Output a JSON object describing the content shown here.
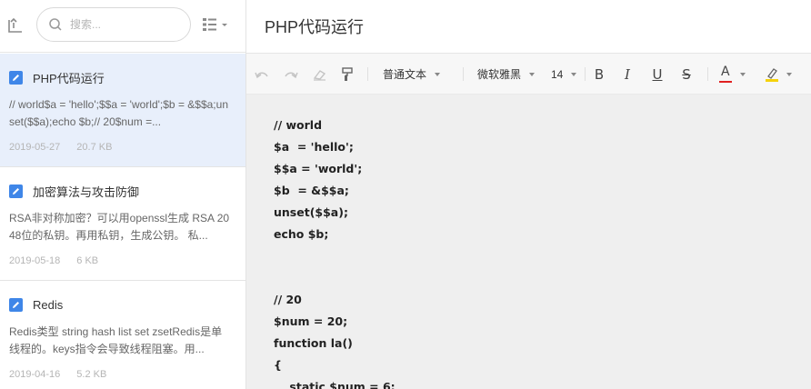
{
  "search": {
    "placeholder": "搜索..."
  },
  "notes": [
    {
      "title": "PHP代码运行",
      "snippet": "// world$a = 'hello';$$a = 'world';$b = &$$a;unset($$a);echo $b;// 20$num =...",
      "date": "2019-05-27",
      "size": "20.7 KB",
      "active": true
    },
    {
      "title": "加密算法与攻击防御",
      "snippet": "RSA非对称加密？可以用openssl生成 RSA 2048位的私钥。再用私钥，生成公钥。 私...",
      "date": "2019-05-18",
      "size": "6 KB",
      "active": false
    },
    {
      "title": "Redis",
      "snippet": "Redis类型 string hash list set zsetRedis是单线程的。keys指令会导致线程阻塞。用...",
      "date": "2019-04-16",
      "size": "5.2 KB",
      "active": false
    }
  ],
  "editor": {
    "title": "PHP代码运行",
    "toolbar": {
      "paragraph_style": "普通文本",
      "font_family": "微软雅黑",
      "font_size": "14",
      "bold": "B",
      "italic": "I",
      "underline": "U",
      "strike": "S",
      "text_color_letter": "A"
    },
    "lines": [
      "// world",
      "$a  = 'hello';",
      "$$a = 'world';",
      "$b  = &$$a;",
      "unset($$a);",
      "echo $b;",
      "",
      "",
      "// 20",
      "$num = 20;",
      "function la()",
      "{",
      "    static $num = 6;"
    ]
  },
  "colors": {
    "accent": "#3f86e8",
    "active_item_bg": "#e8effb",
    "font_color_underline": "#e02020",
    "highlight_underline": "#f5d20a",
    "content_bg": "#efefef"
  },
  "icons": {
    "back": "back-icon",
    "search": "search-icon",
    "view": "list-view-icon",
    "note": "note-edit-icon",
    "undo": "undo-icon",
    "redo": "redo-icon",
    "eraser": "eraser-icon",
    "format_painter": "format-painter-icon",
    "font_color": "font-color-icon",
    "highlight": "highlighter-icon"
  }
}
